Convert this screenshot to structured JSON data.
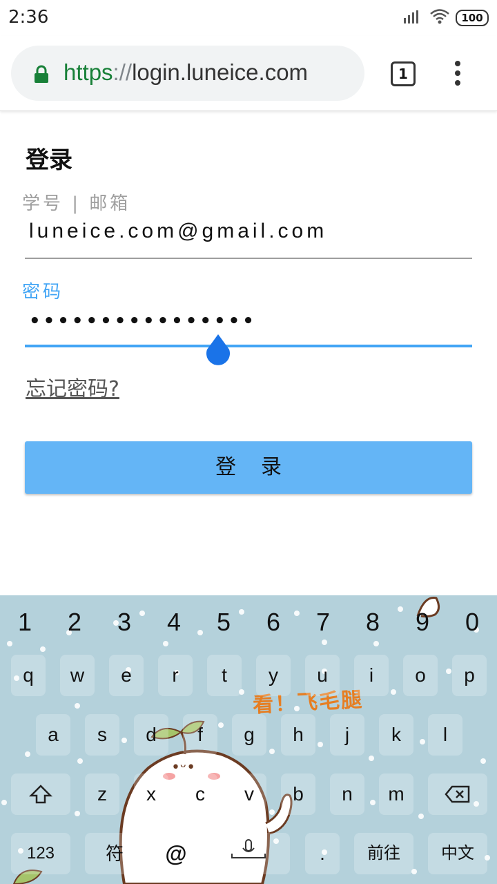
{
  "status_bar": {
    "time": "2:36",
    "battery": "100"
  },
  "browser": {
    "url_scheme": "https",
    "url_separator": "://",
    "url_host": "login.luneice.com",
    "tab_count": "1"
  },
  "form": {
    "title": "登录",
    "username_label": "学号 | 邮箱",
    "username_value": "luneice.com@gmail.com",
    "password_label": "密码",
    "password_mask": "••••••••••••••••",
    "forgot_link": "忘记密码?",
    "submit_label": "登录"
  },
  "keyboard": {
    "numbers": [
      "1",
      "2",
      "3",
      "4",
      "5",
      "6",
      "7",
      "8",
      "9",
      "0"
    ],
    "row1": [
      "q",
      "w",
      "e",
      "r",
      "t",
      "y",
      "u",
      "i",
      "o",
      "p"
    ],
    "row2": [
      "a",
      "s",
      "d",
      "f",
      "g",
      "h",
      "j",
      "k",
      "l"
    ],
    "row3": [
      "z",
      "x",
      "c",
      "v",
      "b",
      "n",
      "m"
    ],
    "bottom": {
      "num_mode": "123",
      "symbol": "符",
      "at": "@",
      "period": ".",
      "go": "前往",
      "lang": "中文"
    },
    "slogan": "看！飞毛腿"
  },
  "colors": {
    "accent": "#42a5f5",
    "button": "#64b5f6",
    "url_green": "#188038"
  }
}
